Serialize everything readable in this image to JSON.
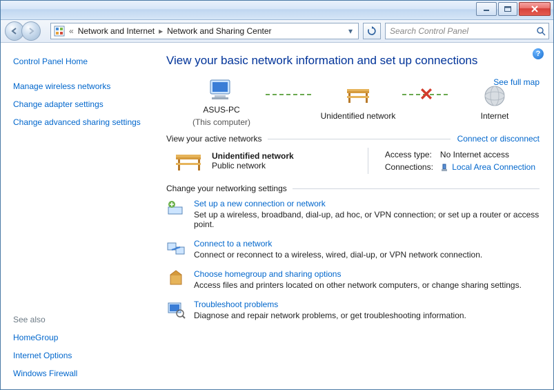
{
  "breadcrumb": {
    "part1": "Network and Internet",
    "part2": "Network and Sharing Center"
  },
  "search": {
    "placeholder": "Search Control Panel"
  },
  "sidebar": {
    "home": "Control Panel Home",
    "links": [
      "Manage wireless networks",
      "Change adapter settings",
      "Change advanced sharing settings"
    ],
    "seealso_label": "See also",
    "seealso": [
      "HomeGroup",
      "Internet Options",
      "Windows Firewall"
    ]
  },
  "page": {
    "title": "View your basic network information and set up connections",
    "see_full_map": "See full map",
    "node_pc": "ASUS-PC",
    "node_pc_sub": "(This computer)",
    "node_mid": "Unidentified network",
    "node_net": "Internet",
    "active_header": "View your active networks",
    "connect_link": "Connect or disconnect",
    "active": {
      "name": "Unidentified network",
      "type": "Public network",
      "access_label": "Access type:",
      "access_value": "No Internet access",
      "conn_label": "Connections:",
      "conn_value": "Local Area Connection"
    },
    "settings_header": "Change your networking settings",
    "settings": [
      {
        "title": "Set up a new connection or network",
        "desc": "Set up a wireless, broadband, dial-up, ad hoc, or VPN connection; or set up a router or access point."
      },
      {
        "title": "Connect to a network",
        "desc": "Connect or reconnect to a wireless, wired, dial-up, or VPN network connection."
      },
      {
        "title": "Choose homegroup and sharing options",
        "desc": "Access files and printers located on other network computers, or change sharing settings."
      },
      {
        "title": "Troubleshoot problems",
        "desc": "Diagnose and repair network problems, or get troubleshooting information."
      }
    ]
  }
}
